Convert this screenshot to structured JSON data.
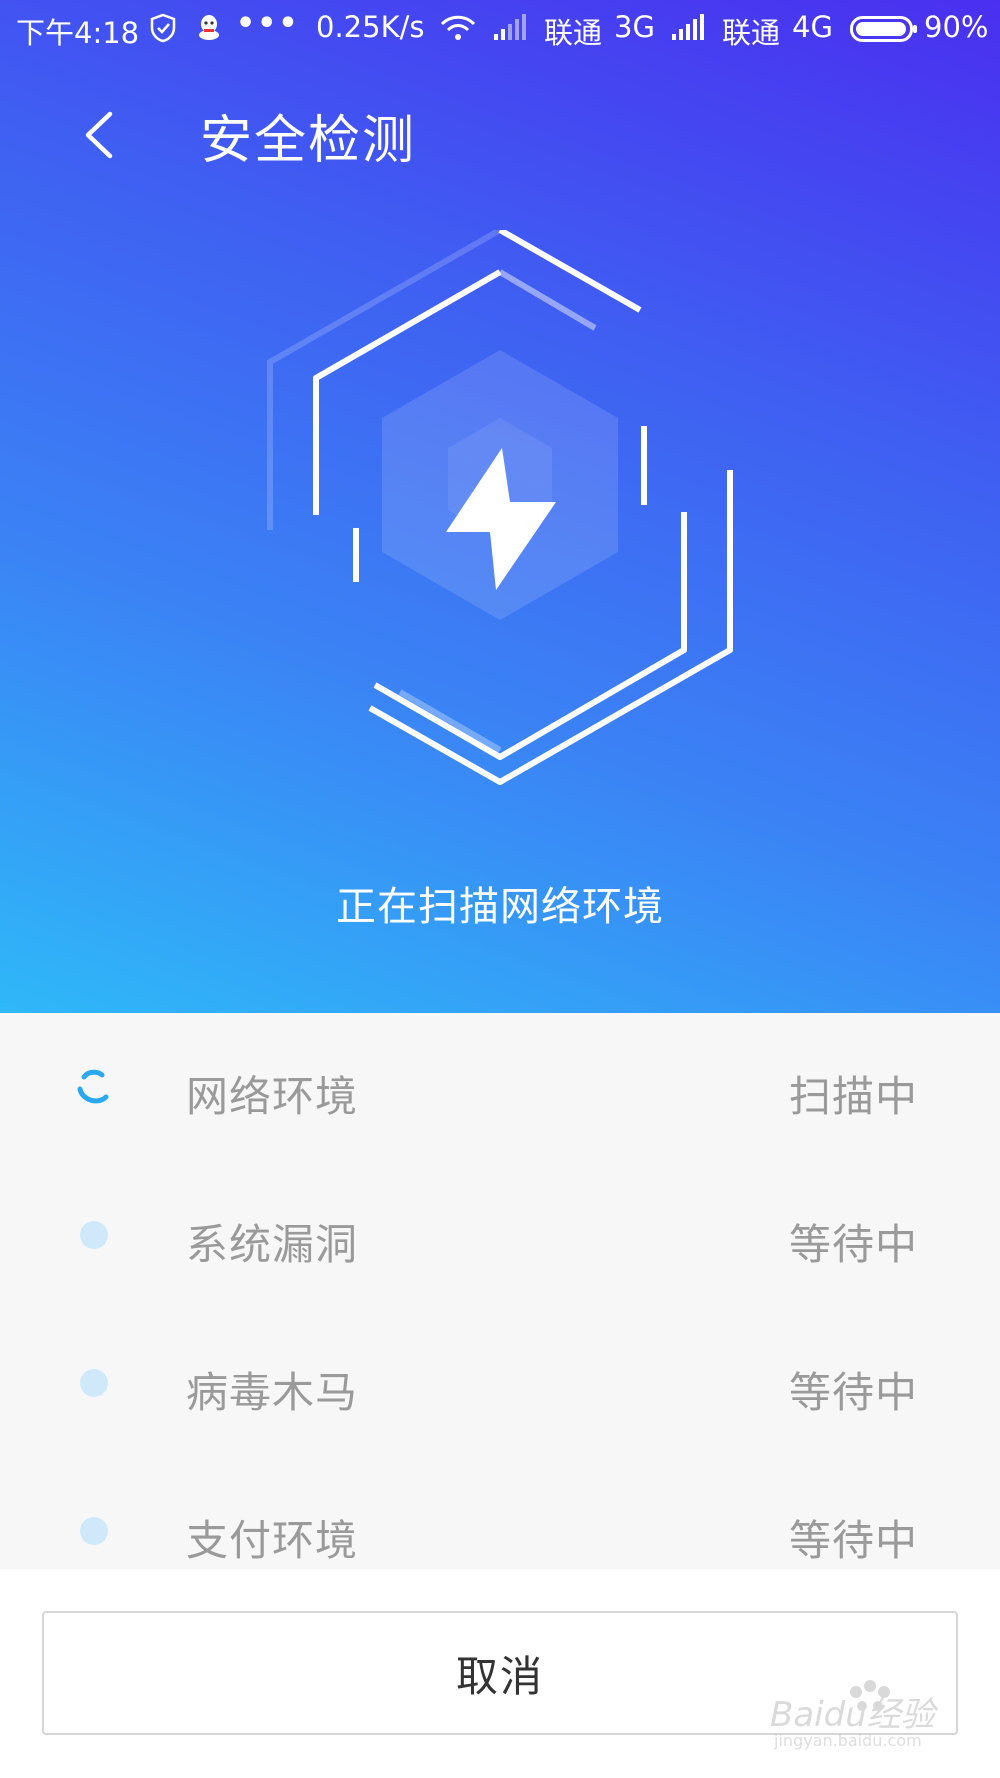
{
  "status_bar": {
    "time": "下午4:18",
    "more": "•••",
    "net_speed": "0.25K/s",
    "carrier1": "联通",
    "network1": "3G",
    "carrier2": "联通",
    "network2": "4G",
    "battery": "90%",
    "icons": [
      "shield-icon",
      "qq-icon",
      "wifi-icon",
      "signal-icon",
      "battery-icon"
    ]
  },
  "header": {
    "back_icon": "chevron-left-icon",
    "title": "安全检测"
  },
  "hero": {
    "graphic_icon": "lightning-icon",
    "status_text": "正在扫描网络环境",
    "colors": {
      "gradient_top": "#4a2ff0",
      "gradient_bottom": "#2fb8f8"
    }
  },
  "scan_items": [
    {
      "label": "网络环境",
      "status": "扫描中",
      "state": "scanning"
    },
    {
      "label": "系统漏洞",
      "status": "等待中",
      "state": "waiting"
    },
    {
      "label": "病毒木马",
      "status": "等待中",
      "state": "waiting"
    },
    {
      "label": "支付环境",
      "status": "等待中",
      "state": "waiting"
    }
  ],
  "footer": {
    "cancel_label": "取消"
  },
  "watermark": {
    "text": "Baidu经验",
    "url_text": "jingyan.baidu.com"
  }
}
